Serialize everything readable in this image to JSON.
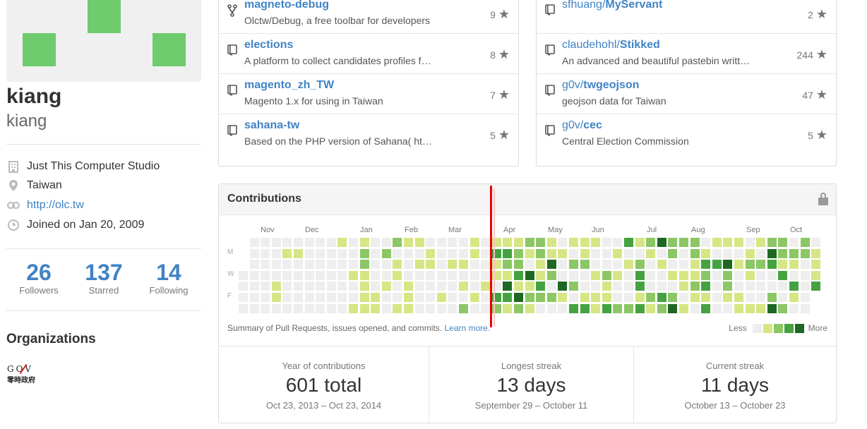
{
  "profile": {
    "fullname": "kiang",
    "username": "kiang",
    "company": "Just This Computer Studio",
    "location": "Taiwan",
    "website": "http://olc.tw",
    "joined": "Joined on Jan 20, 2009"
  },
  "stats": [
    {
      "value": "26",
      "label": "Followers"
    },
    {
      "value": "137",
      "label": "Starred"
    },
    {
      "value": "14",
      "label": "Following"
    }
  ],
  "organizations": {
    "title": "Organizations",
    "logo_text": "GOV",
    "logo_sub": "零時政府"
  },
  "repos_left": [
    {
      "icon": "fork-icon",
      "owner": "",
      "name": "magneto-debug",
      "desc": "Olctw/Debug, a free toolbar for developers",
      "stars": "9"
    },
    {
      "icon": "repo-icon",
      "owner": "",
      "name": "elections",
      "desc": "A platform to collect candidates profiles f…",
      "stars": "8"
    },
    {
      "icon": "repo-icon",
      "owner": "",
      "name": "magento_zh_TW",
      "desc": "Magento 1.x for using in Taiwan",
      "stars": "7"
    },
    {
      "icon": "repo-icon",
      "owner": "",
      "name": "sahana-tw",
      "desc": "Based on the PHP version of Sahana( ht…",
      "stars": "5"
    }
  ],
  "repos_right": [
    {
      "icon": "repo-icon",
      "owner": "sfhuang/",
      "name": "MyServant",
      "desc": "",
      "stars": "2"
    },
    {
      "icon": "repo-icon",
      "owner": "claudehohl/",
      "name": "Stikked",
      "desc": "An advanced and beautiful pastebin writt…",
      "stars": "244"
    },
    {
      "icon": "repo-icon",
      "owner": "g0v/",
      "name": "twgeojson",
      "desc": "geojson data for Taiwan",
      "stars": "47"
    },
    {
      "icon": "repo-icon",
      "owner": "g0v/",
      "name": "cec",
      "desc": "Central Election Commission",
      "stars": "5"
    }
  ],
  "contributions": {
    "title": "Contributions",
    "months": [
      "Nov",
      "Dec",
      "Jan",
      "Feb",
      "Mar",
      "Apr",
      "May",
      "Jun",
      "Jul",
      "Aug",
      "Sep",
      "Oct"
    ],
    "day_labels": [
      "M",
      "W",
      "F"
    ],
    "summary_text": "Summary of Pull Requests, issues opened, and commits.",
    "summary_link": "Learn more.",
    "legend_less": "Less",
    "legend_more": "More",
    "colors": [
      "#eeeeee",
      "#d6e685",
      "#8cc665",
      "#44a340",
      "#1e6823"
    ],
    "stat_boxes": [
      {
        "heading": "Year of contributions",
        "value": "601 total",
        "range": "Oct 23, 2013 – Oct 23, 2014"
      },
      {
        "heading": "Longest streak",
        "value": "13 days",
        "range": "September 29 – October 11"
      },
      {
        "heading": "Current streak",
        "value": "11 days",
        "range": "October 13 – October 23"
      }
    ]
  }
}
